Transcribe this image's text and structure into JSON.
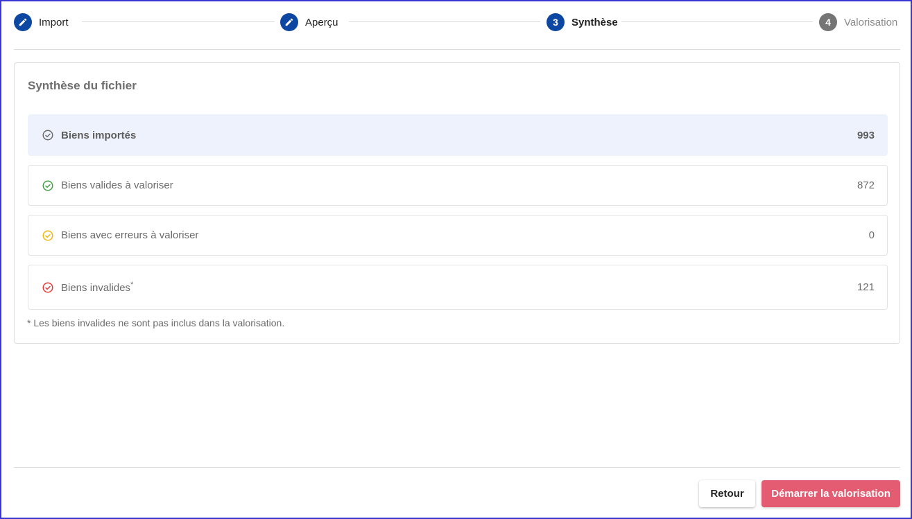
{
  "stepper": {
    "steps": [
      {
        "label": "Import",
        "marker": "",
        "state": "done",
        "icon": "pencil-icon"
      },
      {
        "label": "Aperçu",
        "marker": "",
        "state": "done",
        "icon": "pencil-icon"
      },
      {
        "label": "Synthèse",
        "marker": "3",
        "state": "active"
      },
      {
        "label": "Valorisation",
        "marker": "4",
        "state": "todo"
      }
    ]
  },
  "card": {
    "title": "Synthèse du fichier",
    "rows": [
      {
        "label": "Biens importés",
        "value": "993",
        "icon": "check-circle-icon",
        "color": "#6b6b6b"
      },
      {
        "label": "Biens valides à valoriser",
        "value": "872",
        "icon": "check-circle-icon",
        "color": "#43a047"
      },
      {
        "label": "Biens avec erreurs à valoriser",
        "value": "0",
        "icon": "check-circle-icon",
        "color": "#f2b705"
      },
      {
        "label": "Biens invalides",
        "label_sup": "*",
        "value": "121",
        "icon": "check-circle-icon",
        "color": "#e53935"
      }
    ],
    "footnote": "* Les biens invalides ne sont pas inclus dans la valorisation."
  },
  "actions": {
    "back_label": "Retour",
    "start_label": "Démarrer la valorisation"
  },
  "colors": {
    "primary": "#0d47a1",
    "accent": "#e35c72",
    "highlight": "#edf2fc"
  }
}
